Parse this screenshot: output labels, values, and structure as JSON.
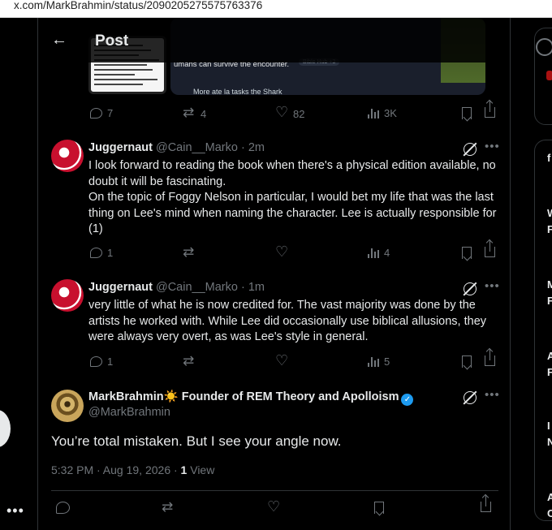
{
  "browser": {
    "url": "x.com/MarkBrahmin/status/2090205275575763376"
  },
  "header": {
    "back_icon": "arrow-left-icon",
    "title": "Post"
  },
  "quoted_media": {
    "caption": "umans can survive the encounter.",
    "tag": "Bible Hub +3",
    "blur_text": "More ate la tasks the Shark"
  },
  "prev_actions": {
    "replies": "7",
    "reposts": "4",
    "likes": "82",
    "views": "3K"
  },
  "tweets": [
    {
      "name": "Juggernaut",
      "handle": "@Cain__Marko",
      "time": "· 2m",
      "body": "I look forward to reading the book when there's a physical edition available, no doubt it will be fascinating.\nOn the topic of Foggy Nelson in particular, I would bet my life that was the last thing on Lee's mind when naming the character. Lee is actually responsible for (1)",
      "replies": "1",
      "views": "4"
    },
    {
      "name": "Juggernaut",
      "handle": "@Cain__Marko",
      "time": "· 1m",
      "body": "very little of what he is now credited for. The vast majority was done by the artists he worked with. While Lee did occasionally use biblical allusions, they were always very overt, as was Lee's style in general.",
      "replies": "1",
      "views": "5"
    }
  ],
  "main_tweet": {
    "name": "MarkBrahmin",
    "emoji": "☀️",
    "title": "Founder of REM Theory and Apolloism",
    "handle": "@MarkBrahmin",
    "text": "You’re total mistaken. But I see your angle now.",
    "time": "5:32 PM · Aug 19, 2026 · ",
    "views_count": "1",
    "views_label": " View"
  },
  "right_sidebar": {
    "letters": [
      "W",
      "F",
      "M",
      "F",
      "A",
      "F",
      "I",
      "N",
      "A",
      "C"
    ]
  }
}
